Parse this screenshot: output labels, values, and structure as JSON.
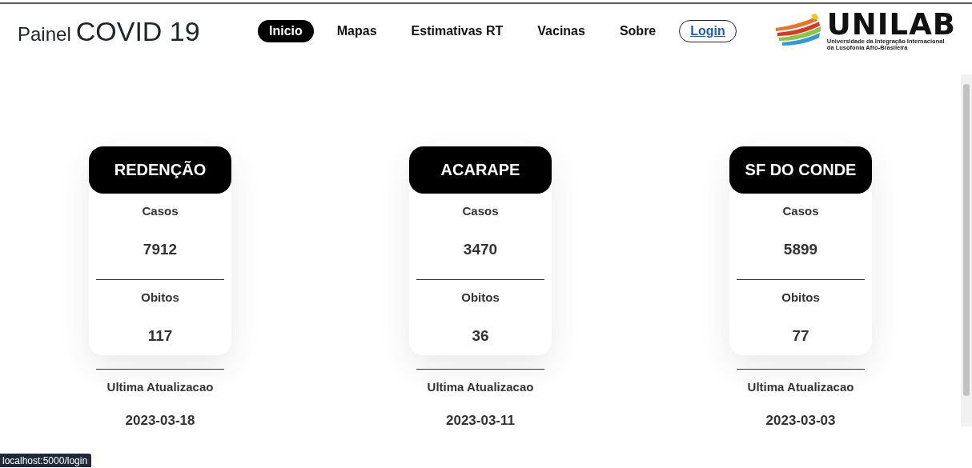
{
  "header": {
    "title_prefix": "Painel",
    "title": "COVID 19",
    "nav": [
      {
        "label": "Inicio",
        "kind": "link",
        "selected": true
      },
      {
        "label": "Mapas",
        "kind": "link",
        "selected": false
      },
      {
        "label": "Estimativas RT",
        "kind": "link",
        "selected": false
      },
      {
        "label": "Vacinas",
        "kind": "link",
        "selected": false
      },
      {
        "label": "Sobre",
        "kind": "link",
        "selected": false
      },
      {
        "label": "Login",
        "kind": "button",
        "selected": false
      }
    ],
    "logo": {
      "name": "UNILAB",
      "subtitle_lines": [
        "Universidade da Integração Internacional",
        "da Lusofonia Afro-Brasileira"
      ]
    }
  },
  "cities": [
    {
      "name": "REDENÇÃO",
      "cases_label": "Casos",
      "cases": "7912",
      "deaths_label": "Obitos",
      "deaths": "117",
      "updated_label": "Ultima Atualizacao",
      "updated": "2023-03-18"
    },
    {
      "name": "ACARAPE",
      "cases_label": "Casos",
      "cases": "3470",
      "deaths_label": "Obitos",
      "deaths": "36",
      "updated_label": "Ultima Atualizacao",
      "updated": "2023-03-11"
    },
    {
      "name": "SF DO CONDE",
      "cases_label": "Casos",
      "cases": "5899",
      "deaths_label": "Obitos",
      "deaths": "77",
      "updated_label": "Ultima Atualizacao",
      "updated": "2023-03-03"
    }
  ],
  "status_bar": {
    "url": "localhost:5000/login"
  }
}
